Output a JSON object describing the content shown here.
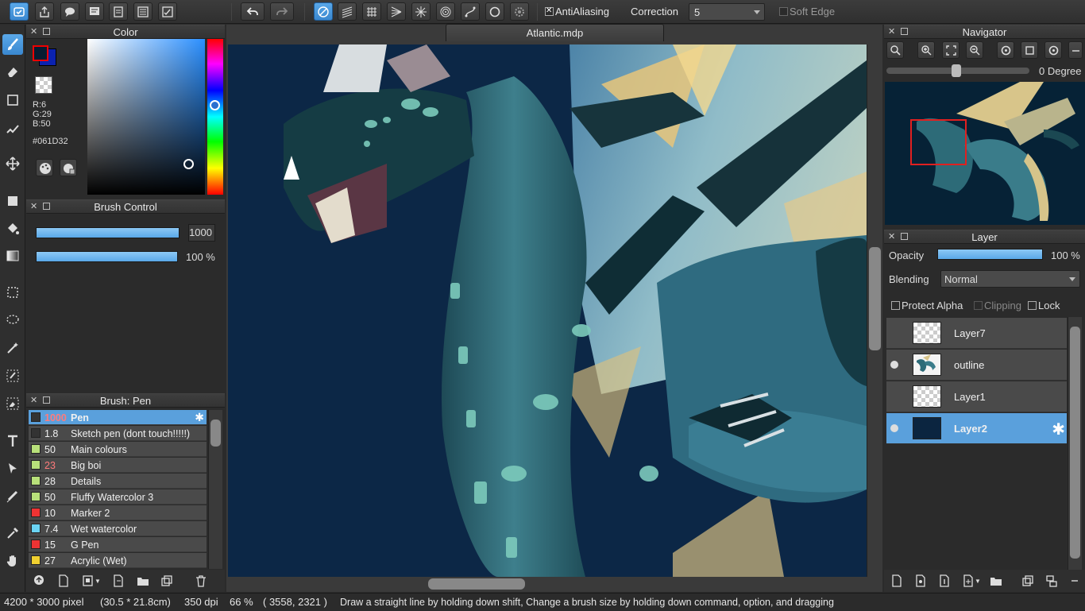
{
  "toolbar": {
    "antialiasing_label": "AntiAliasing",
    "correction_label": "Correction",
    "correction_value": "5",
    "soft_edge_label": "Soft Edge"
  },
  "canvas": {
    "tab_title": "Atlantic.mdp"
  },
  "color_panel": {
    "title": "Color",
    "r": "R:6",
    "g": "G:29",
    "b": "B:50",
    "hex": "#061D32",
    "primary_color": "#061D32",
    "secondary_color": "#0b22b0"
  },
  "brush_control": {
    "title": "Brush Control",
    "size_value": "1000",
    "opacity_value": "100 %"
  },
  "brush_panel": {
    "title": "Brush: Pen",
    "items": [
      {
        "size": "1000",
        "name": "Pen",
        "color": "#333333",
        "size_color": "#ff7b7b",
        "selected": true
      },
      {
        "size": "1.8",
        "name": "Sketch pen (dont touch!!!!!)",
        "color": "#333333",
        "size_color": "#f0f0f0"
      },
      {
        "size": "50",
        "name": "Main colours",
        "color": "#b8e07a",
        "size_color": "#f0f0f0"
      },
      {
        "size": "23",
        "name": "Big boi",
        "color": "#b8e07a",
        "size_color": "#ff7b7b"
      },
      {
        "size": "28",
        "name": "Details",
        "color": "#b8e07a",
        "size_color": "#f0f0f0"
      },
      {
        "size": "50",
        "name": "Fluffy Watercolor 3",
        "color": "#b8e07a",
        "size_color": "#f0f0f0"
      },
      {
        "size": "10",
        "name": "Marker 2",
        "color": "#ee3333",
        "size_color": "#f0f0f0"
      },
      {
        "size": "7.4",
        "name": "Wet watercolor",
        "color": "#6ad4f4",
        "size_color": "#f0f0f0"
      },
      {
        "size": "15",
        "name": "G Pen",
        "color": "#ee3333",
        "size_color": "#f0f0f0"
      },
      {
        "size": "27",
        "name": "Acrylic (Wet)",
        "color": "#f0d030",
        "size_color": "#f0f0f0"
      }
    ]
  },
  "navigator": {
    "title": "Navigator",
    "rotation": "0 Degree"
  },
  "layer_panel": {
    "title": "Layer",
    "opacity_label": "Opacity",
    "opacity_value": "100 %",
    "blending_label": "Blending",
    "blending_value": "Normal",
    "protect_alpha": "Protect Alpha",
    "clipping": "Clipping",
    "lock": "Lock",
    "layers": [
      {
        "name": "Layer7",
        "visible": false,
        "selected": false,
        "thumb": "transparent"
      },
      {
        "name": "outline",
        "visible": true,
        "selected": false,
        "thumb": "dragon"
      },
      {
        "name": "Layer1",
        "visible": false,
        "selected": false,
        "thumb": "transparent"
      },
      {
        "name": "Layer2",
        "visible": true,
        "selected": true,
        "thumb": "navy"
      }
    ]
  },
  "status": {
    "dimensions": "4200 * 3000 pixel",
    "physical_size": "(30.5 * 21.8cm)",
    "dpi": "350 dpi",
    "zoom": "66 %",
    "coords": "( 3558, 2321 )",
    "hint": "Draw a straight line by holding down shift, Change a brush size by holding down command, option, and dragging"
  }
}
